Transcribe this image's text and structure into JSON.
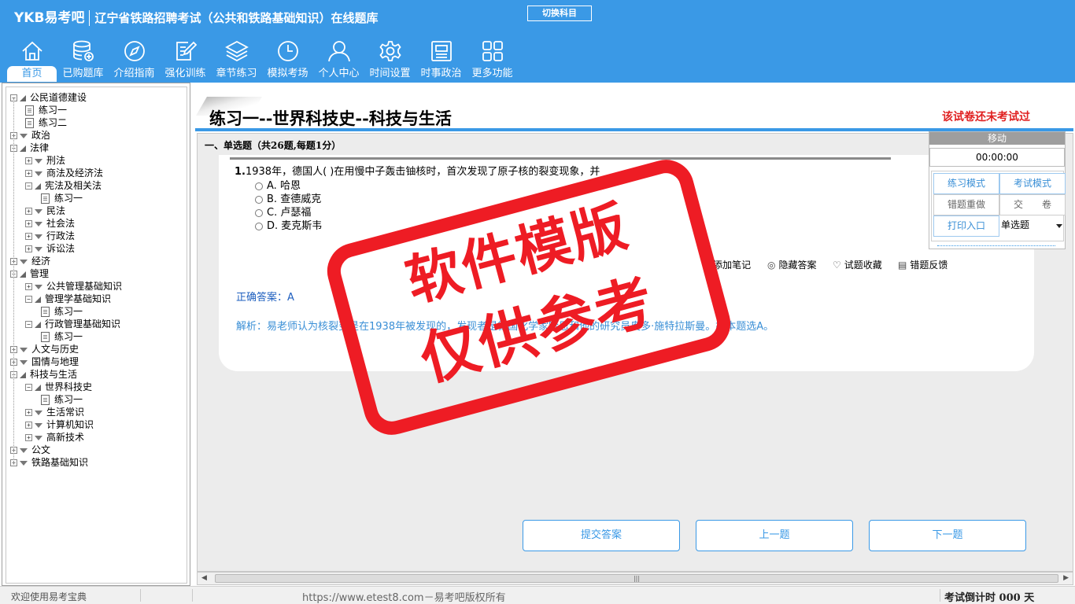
{
  "header": {
    "logo": "YKB易考吧",
    "app_title": "辽宁省铁路招聘考试（公共和铁路基础知识）在线题库",
    "switch_subject": "切换科目"
  },
  "nav": [
    {
      "label": "首页",
      "icon": "home-icon"
    },
    {
      "label": "已购题库",
      "icon": "database-icon"
    },
    {
      "label": "介绍指南",
      "icon": "compass-icon"
    },
    {
      "label": "强化训练",
      "icon": "edit-icon"
    },
    {
      "label": "章节练习",
      "icon": "layers-icon"
    },
    {
      "label": "模拟考场",
      "icon": "clock-icon"
    },
    {
      "label": "个人中心",
      "icon": "user-icon"
    },
    {
      "label": "时间设置",
      "icon": "gear-icon"
    },
    {
      "label": "时事政治",
      "icon": "news-icon"
    },
    {
      "label": "更多功能",
      "icon": "grid-icon"
    }
  ],
  "tree": [
    {
      "label": "公民道德建设",
      "level": 0,
      "state": "open"
    },
    {
      "label": "练习一",
      "level": 1,
      "state": "leaf"
    },
    {
      "label": "练习二",
      "level": 1,
      "state": "leaf"
    },
    {
      "label": "政治",
      "level": 0,
      "state": "closed"
    },
    {
      "label": "法律",
      "level": 0,
      "state": "open"
    },
    {
      "label": "刑法",
      "level": 1,
      "state": "closed"
    },
    {
      "label": "商法及经济法",
      "level": 1,
      "state": "closed"
    },
    {
      "label": "宪法及相关法",
      "level": 1,
      "state": "open"
    },
    {
      "label": "练习一",
      "level": 2,
      "state": "leaf"
    },
    {
      "label": "民法",
      "level": 1,
      "state": "closed"
    },
    {
      "label": "社会法",
      "level": 1,
      "state": "closed"
    },
    {
      "label": "行政法",
      "level": 1,
      "state": "closed"
    },
    {
      "label": "诉讼法",
      "level": 1,
      "state": "closed"
    },
    {
      "label": "经济",
      "level": 0,
      "state": "closed"
    },
    {
      "label": "管理",
      "level": 0,
      "state": "open"
    },
    {
      "label": "公共管理基础知识",
      "level": 1,
      "state": "closed"
    },
    {
      "label": "管理学基础知识",
      "level": 1,
      "state": "open"
    },
    {
      "label": "练习一",
      "level": 2,
      "state": "leaf"
    },
    {
      "label": "行政管理基础知识",
      "level": 1,
      "state": "open"
    },
    {
      "label": "练习一",
      "level": 2,
      "state": "leaf"
    },
    {
      "label": "人文与历史",
      "level": 0,
      "state": "closed"
    },
    {
      "label": "国情与地理",
      "level": 0,
      "state": "closed"
    },
    {
      "label": "科技与生活",
      "level": 0,
      "state": "open"
    },
    {
      "label": "世界科技史",
      "level": 1,
      "state": "open"
    },
    {
      "label": "练习一",
      "level": 2,
      "state": "leaf"
    },
    {
      "label": "生活常识",
      "level": 1,
      "state": "closed"
    },
    {
      "label": "计算机知识",
      "level": 1,
      "state": "closed"
    },
    {
      "label": "高新技术",
      "level": 1,
      "state": "closed"
    },
    {
      "label": "公文",
      "level": 0,
      "state": "closed"
    },
    {
      "label": "铁路基础知识",
      "level": 0,
      "state": "closed"
    }
  ],
  "paper": {
    "title": "练习一--世界科技史--科技与生活",
    "status": "该试卷还未考试过",
    "section": "一、单选题（共26题,每题1分）"
  },
  "question": {
    "number": "1.",
    "stem": "1938年，德国人( )在用慢中子轰击铀核时，首次发现了原子核的裂变现象，并",
    "options": [
      {
        "key": "A.",
        "text": "哈恩"
      },
      {
        "key": "B.",
        "text": "查德威克"
      },
      {
        "key": "C.",
        "text": "卢瑟福"
      },
      {
        "key": "D.",
        "text": "麦克斯韦"
      }
    ],
    "tools": {
      "add_note": "添加笔记",
      "hide_answer": "隐藏答案",
      "favorite": "试题收藏",
      "feedback": "错题反馈"
    },
    "answer_label": "正确答案：",
    "answer_value": "A",
    "analysis": "解析：易老师认为核裂变是在1938年被发现的，发现者是德国化学家哈恩和他的研究员奥多·施特拉斯曼。故本题选A。"
  },
  "actions": {
    "submit": "提交答案",
    "prev": "上一题",
    "next": "下一题"
  },
  "float_panel": {
    "move": "移动",
    "timer": "00:00:00",
    "practice_mode": "练习模式",
    "exam_mode": "考试模式",
    "redo_wrong": "错题重做",
    "hand_in": "交　　卷",
    "print": "打印入口",
    "question_type": "单选题"
  },
  "watermark": {
    "line1": "软件模版",
    "line2": "仅供参考"
  },
  "status_bar": {
    "welcome": "欢迎使用易考宝典",
    "site": "https://www.etest8.com－易考吧版权所有",
    "countdown": "考试倒计时 000 天"
  },
  "colors": {
    "header_blue": "#3a99e6",
    "stamp_red": "#ee1c24",
    "status_red": "#e02020"
  }
}
